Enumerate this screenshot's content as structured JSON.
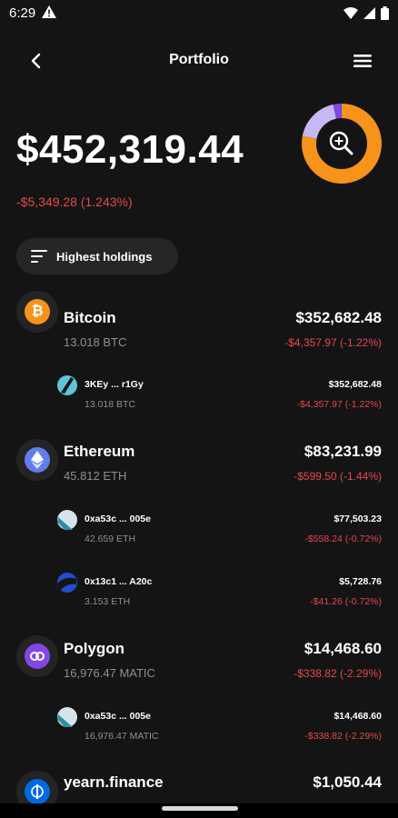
{
  "status": {
    "time": "6:29"
  },
  "header": {
    "title": "Portfolio"
  },
  "portfolio": {
    "balance": "$452,319.44",
    "change": "-$5,349.28 (1.243%)"
  },
  "sort": {
    "label": "Highest holdings"
  },
  "allocation": {
    "segments": [
      {
        "name": "Bitcoin",
        "fraction": 0.78,
        "color": "#f7931a"
      },
      {
        "name": "Ethereum",
        "fraction": 0.184,
        "color": "#c5b8f5"
      },
      {
        "name": "Polygon",
        "fraction": 0.032,
        "color": "#8247e5"
      },
      {
        "name": "yearn.finance",
        "fraction": 0.004,
        "color": "#006ae3"
      }
    ]
  },
  "holdings": [
    {
      "name": "Bitcoin",
      "amount": "13.018 BTC",
      "value": "$352,682.48",
      "change": "-$4,357.97 (-1.22%)",
      "icon": "bitcoin-icon",
      "color": "#f7931a",
      "wallets": [
        {
          "name": "3KEy ... r1Gy",
          "amount": "13.018 BTC",
          "value": "$352,682.48",
          "change": "-$4,357.97 (-1.22%)",
          "icon": "wallet-icon"
        }
      ]
    },
    {
      "name": "Ethereum",
      "amount": "45.812 ETH",
      "value": "$83,231.99",
      "change": "-$599.50 (-1.44%)",
      "icon": "ethereum-icon",
      "color": "#627eea",
      "wallets": [
        {
          "name": "0xa53c ... 005e",
          "amount": "42.659 ETH",
          "value": "$77,503.23",
          "change": "-$558.24 (-0.72%)",
          "icon": "wallet-icon"
        },
        {
          "name": "0x13c1 ... A20c",
          "amount": "3.153 ETH",
          "value": "$5,728.76",
          "change": "-$41.26 (-0.72%)",
          "icon": "wallet-icon"
        }
      ]
    },
    {
      "name": "Polygon",
      "amount": "16,976.47 MATIC",
      "value": "$14,468.60",
      "change": "-$338.82 (-2.29%)",
      "icon": "polygon-icon",
      "color": "#8247e5",
      "wallets": [
        {
          "name": "0xa53c ... 005e",
          "amount": "16,976.47 MATIC",
          "value": "$14,468.60",
          "change": "-$338.82 (-2.29%)",
          "icon": "wallet-icon"
        }
      ]
    },
    {
      "name": "yearn.finance",
      "amount": "",
      "value": "$1,050.44",
      "change": "",
      "icon": "yearn-icon",
      "color": "#006ae3",
      "wallets": []
    }
  ]
}
